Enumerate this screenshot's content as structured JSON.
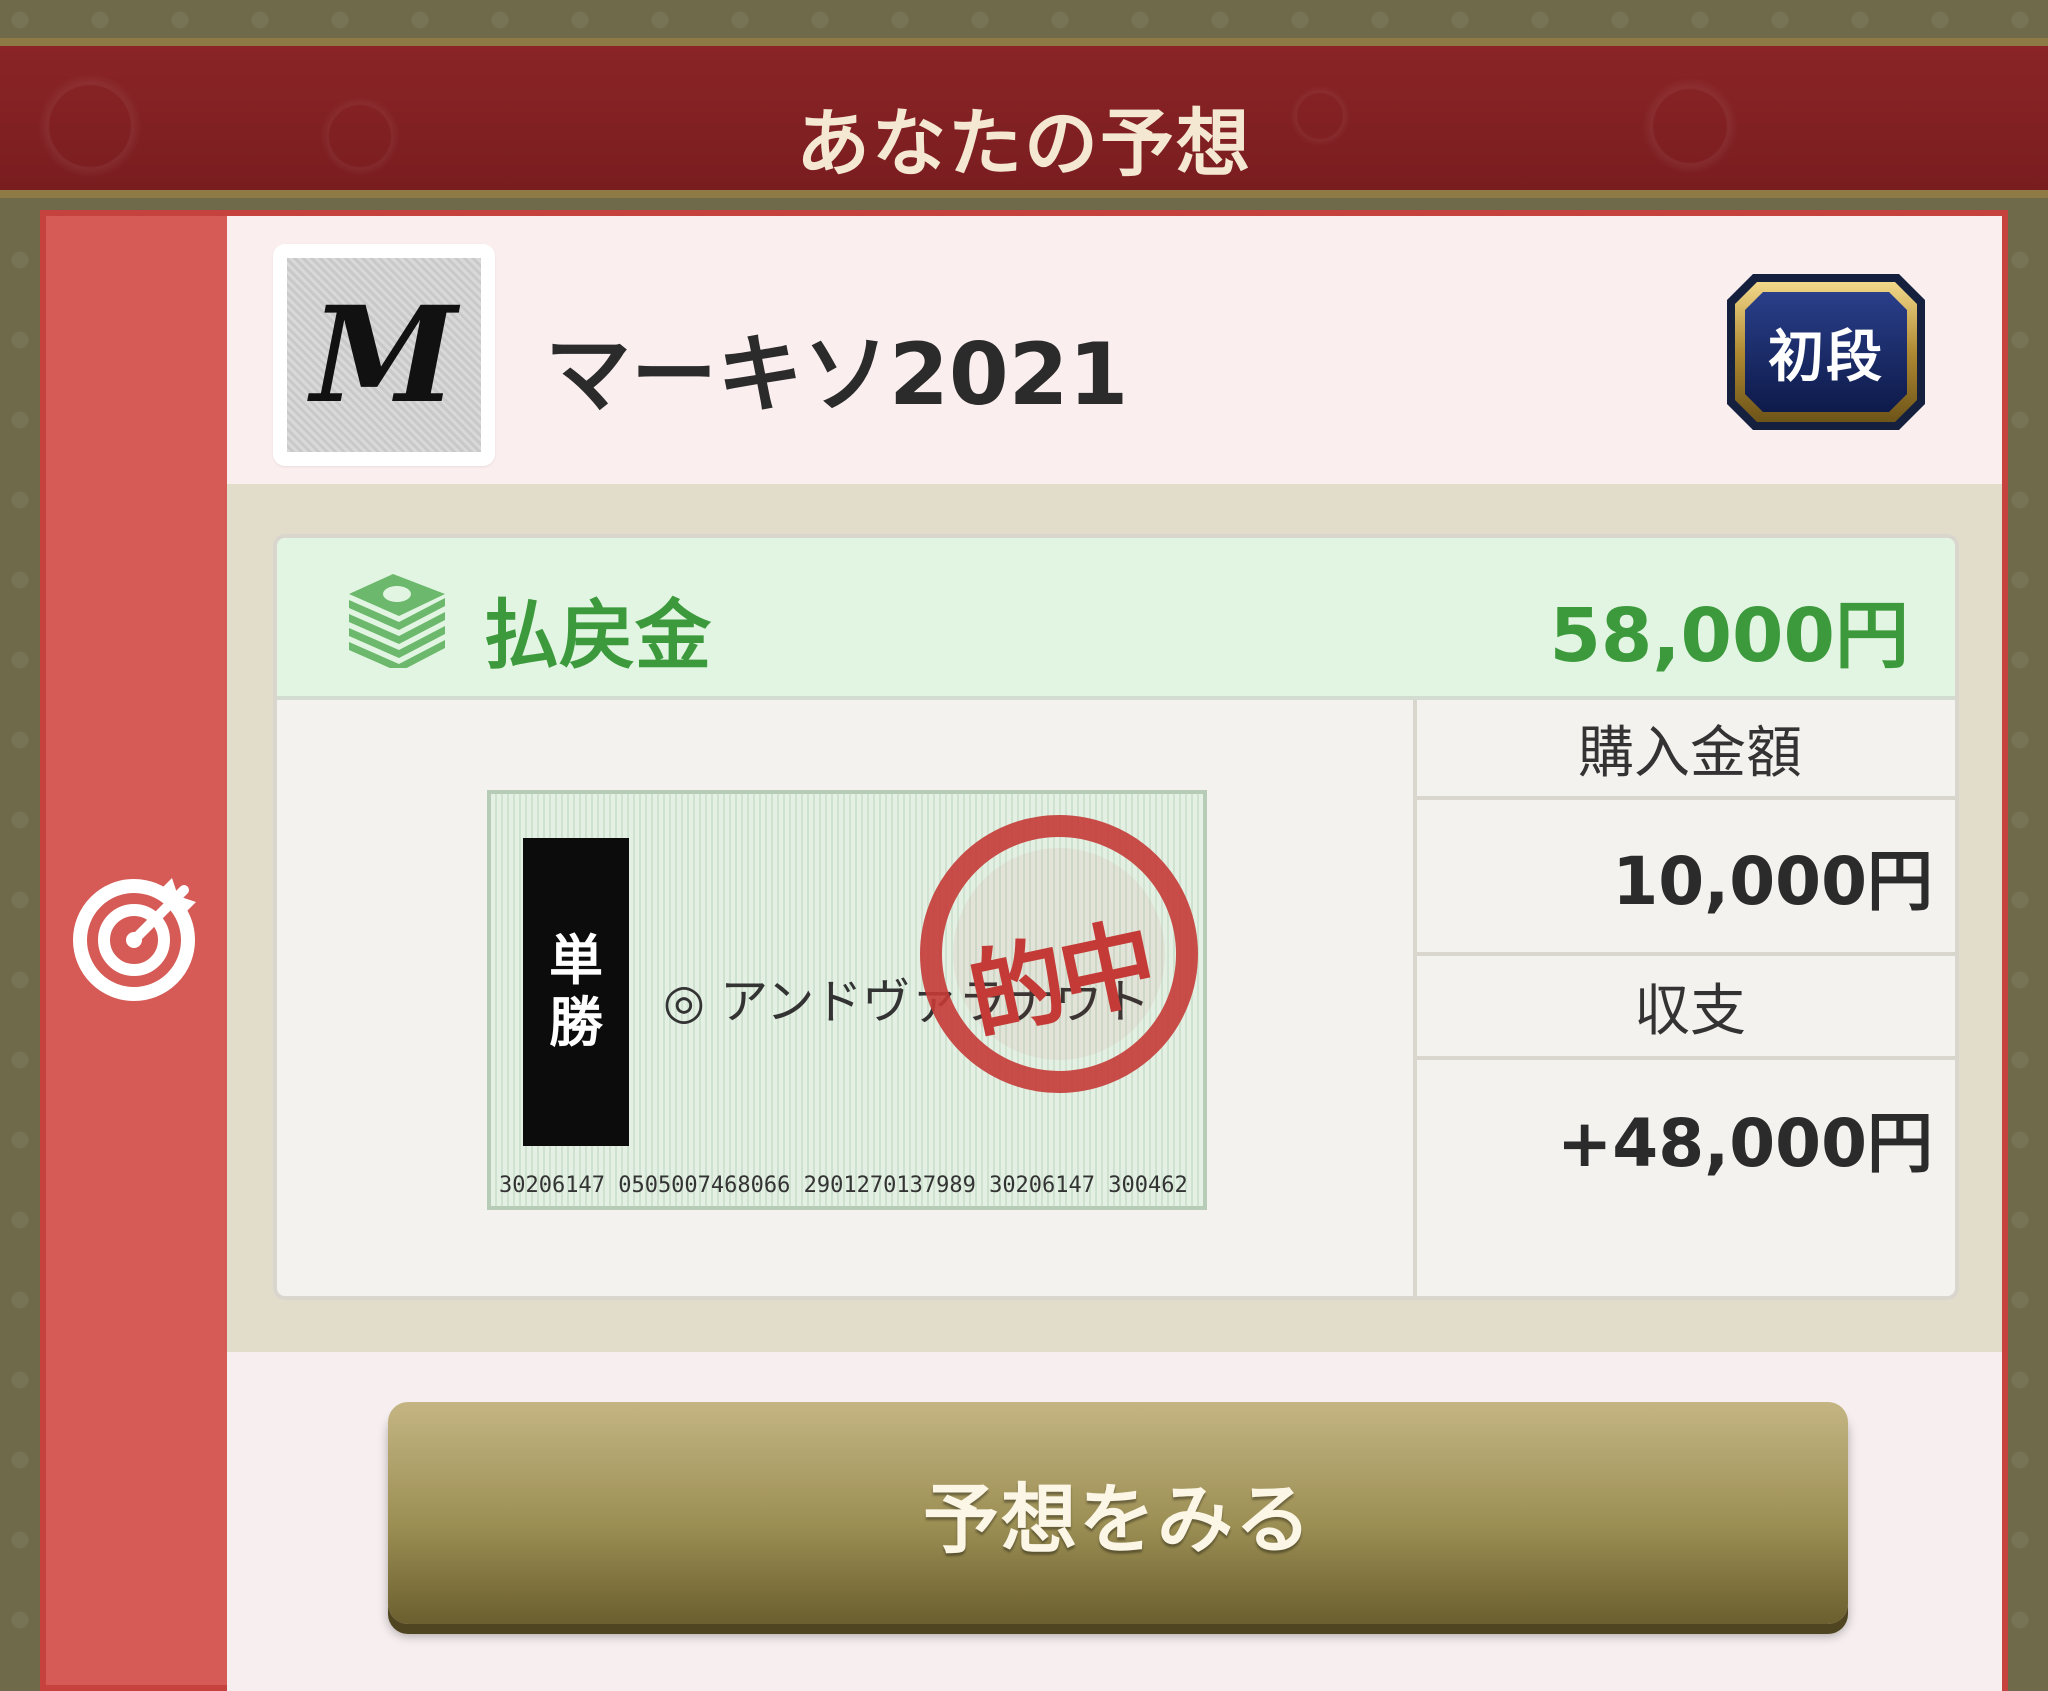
{
  "header": {
    "title": "あなたの予想"
  },
  "user": {
    "avatar_letter": "M",
    "name": "マーキソ2021",
    "rank": "初段"
  },
  "payout": {
    "label": "払戻金",
    "amount": "58,000円"
  },
  "ticket": {
    "bet_type": [
      "単",
      "勝"
    ],
    "horse": "◎ アンドヴァラナウト",
    "stamp": "的中",
    "serial": "30206147   0505007468066 2901270137989 30206147 300462"
  },
  "summary": {
    "purchase_label": "購入金額",
    "purchase_value": "10,000円",
    "balance_label": "収支",
    "balance_value": "+48,000円"
  },
  "button": {
    "label": "予想をみる"
  },
  "colors": {
    "header_red": "#7a1d20",
    "card_red": "#d65a55",
    "payout_green": "#3c9a3c",
    "stamp_red": "#c43a36",
    "button_gold": "#9c8f54"
  },
  "icons": [
    "target-icon",
    "money-stack-icon"
  ]
}
